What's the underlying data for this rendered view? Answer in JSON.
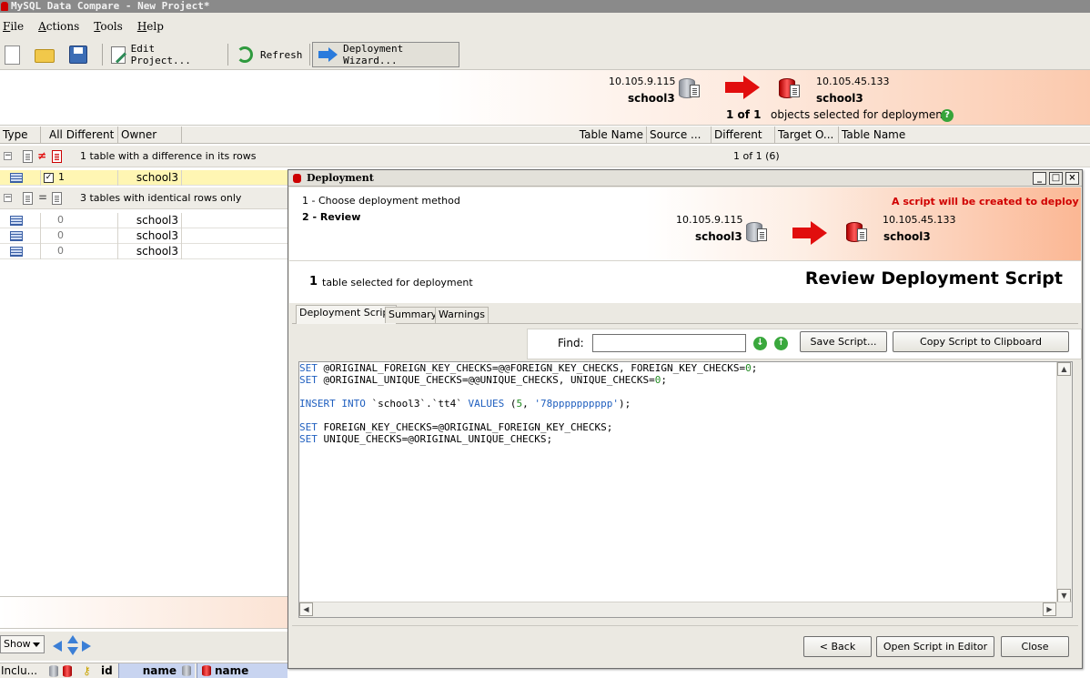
{
  "window": {
    "title": "MySQL Data Compare - New Project*"
  },
  "menu": [
    "File",
    "Actions",
    "Tools",
    "Help"
  ],
  "toolbar": {
    "edit_project": "Edit Project...",
    "refresh": "Refresh",
    "deployment_wizard": "Deployment Wizard..."
  },
  "banner": {
    "source_ip": "10.105.9.115",
    "source_db": "school3",
    "target_ip": "10.105.45.133",
    "target_db": "school3",
    "count": "1 of 1",
    "count_text": "objects selected for deployment"
  },
  "columns": {
    "type": "Type",
    "all_different": "All Different",
    "owner": "Owner",
    "table_name": "Table Name",
    "source": "Source ...",
    "different": "Different",
    "target": "Target O...",
    "table_name2": "Table Name"
  },
  "groups": {
    "diff": {
      "label": "1 table with a difference in its rows",
      "count": "1 of 1 (6)"
    },
    "identical": {
      "label": "3 tables with identical rows only"
    }
  },
  "rows_diff": [
    {
      "value": "1",
      "owner": "school3"
    }
  ],
  "rows_identical": [
    {
      "value": "0",
      "owner": "school3"
    },
    {
      "value": "0",
      "owner": "school3"
    },
    {
      "value": "0",
      "owner": "school3"
    }
  ],
  "bottom": {
    "show": "Show",
    "cols": [
      "Inclu...",
      "id",
      "name",
      "name"
    ]
  },
  "dialog": {
    "title": "Deployment",
    "steps": [
      "1 - Choose deployment method",
      "2 - Review"
    ],
    "warning": "A script will be created to deploy",
    "source_ip": "10.105.9.115",
    "source_db": "school3",
    "target_ip": "10.105.45.133",
    "target_db": "school3",
    "selected_count": "1",
    "selected_text": "table selected for deployment",
    "heading": "Review Deployment Script",
    "tabs": [
      "Deployment Script",
      "Summary",
      "Warnings"
    ],
    "find_label": "Find:",
    "find_value": "",
    "save_script": "Save Script...",
    "copy_script": "Copy Script to Clipboard",
    "back": "< Back",
    "open_editor": "Open Script in Editor",
    "close": "Close"
  },
  "script": {
    "line1_kw": "SET",
    "line1_a": " @ORIGINAL_FOREIGN_KEY_CHECKS=@@FOREIGN_KEY_CHECKS, FOREIGN_KEY_CHECKS=",
    "line1_num": "0",
    "line1_end": ";",
    "line2_kw": "SET",
    "line2_a": " @ORIGINAL_UNIQUE_CHECKS=@@UNIQUE_CHECKS, UNIQUE_CHECKS=",
    "line2_num": "0",
    "line2_end": ";",
    "line3_kw1": "INSERT INTO",
    "line3_tbl": " `school3`.`tt4` ",
    "line3_kw2": "VALUES",
    "line3_open": " (",
    "line3_num": "5",
    "line3_sep": ", ",
    "line3_str": "'78pppppppppp'",
    "line3_end": ");",
    "line4_kw": "SET",
    "line4_a": " FOREIGN_KEY_CHECKS=@ORIGINAL_FOREIGN_KEY_CHECKS;",
    "line5_kw": "SET",
    "line5_a": " UNIQUE_CHECKS=@ORIGINAL_UNIQUE_CHECKS;"
  },
  "colors": {
    "accent_red": "#e10e0e",
    "warning_text": "#d00000",
    "selected_row": "#fff6b3"
  }
}
